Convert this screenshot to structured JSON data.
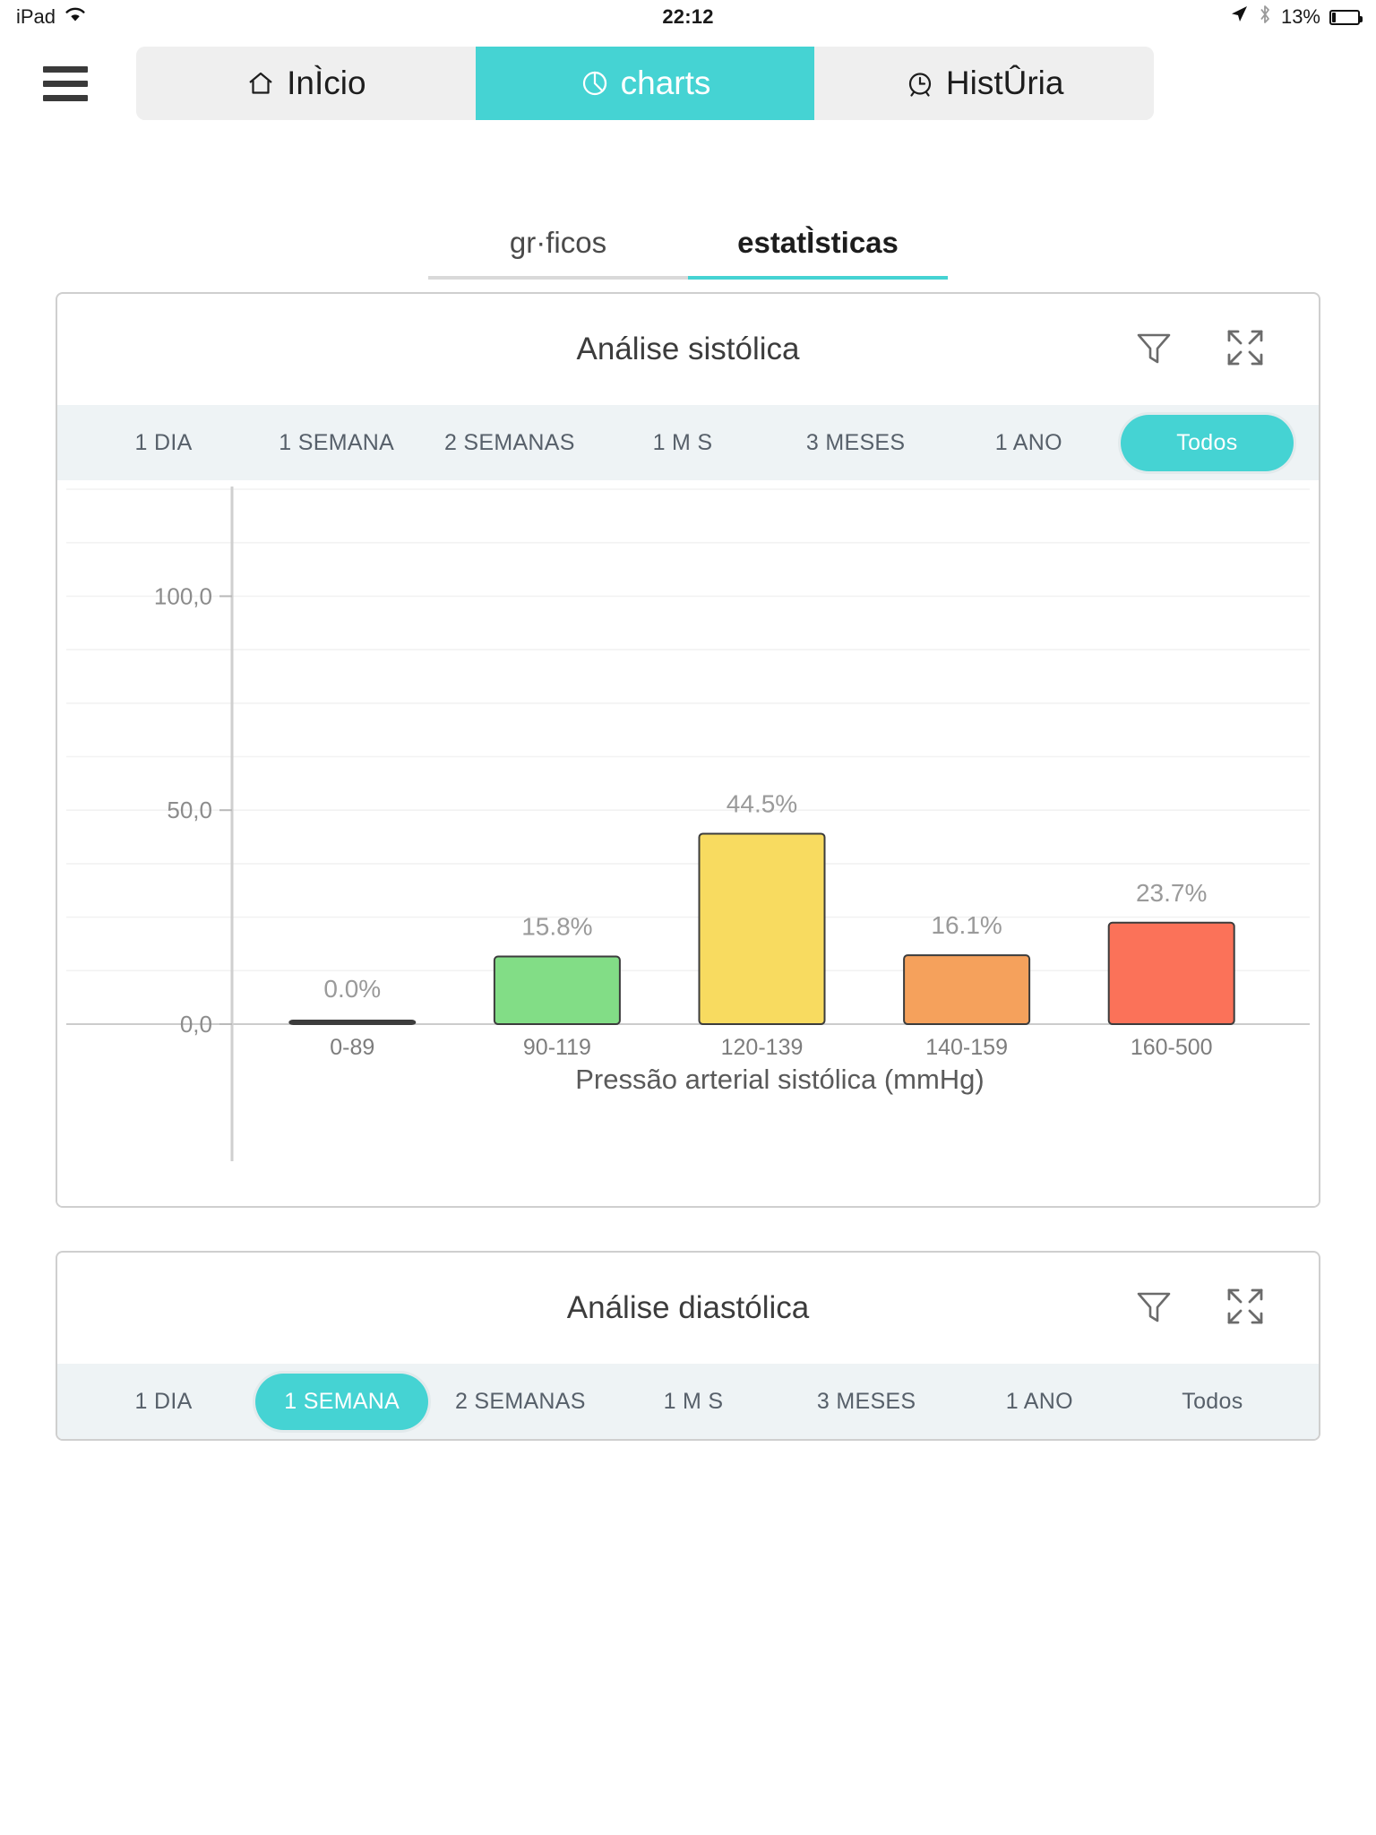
{
  "status_bar": {
    "device": "iPad",
    "wifi_icon": "wifi-icon",
    "time": "22:12",
    "location_icon": "location-arrow-icon",
    "bluetooth_icon": "bluetooth-icon",
    "battery_percent": "13%",
    "battery_level": 13
  },
  "top_nav": {
    "menu_icon": "hamburger-menu-icon",
    "tabs": [
      {
        "label": "InÌcio",
        "icon": "home-icon",
        "active": false
      },
      {
        "label": "charts",
        "icon": "pie-chart-icon",
        "active": true
      },
      {
        "label": "HistÛria",
        "icon": "alarm-clock-icon",
        "active": false
      }
    ]
  },
  "sub_tabs": [
    {
      "label": "gr·ficos",
      "active": false
    },
    {
      "label": "estatÌsticas",
      "active": true
    }
  ],
  "cards": [
    {
      "title": "Análise sistólica",
      "filter_icon": "filter-funnel-icon",
      "expand_icon": "expand-fullscreen-icon",
      "periods": [
        {
          "label": "1 DIA",
          "active": false
        },
        {
          "label": "1 SEMANA",
          "active": false
        },
        {
          "label": "2 SEMANAS",
          "active": false
        },
        {
          "label": "1 M S",
          "active": false
        },
        {
          "label": "3 MESES",
          "active": false
        },
        {
          "label": "1 ANO",
          "active": false
        },
        {
          "label": "Todos",
          "active": true
        }
      ]
    },
    {
      "title": "Análise diastólica",
      "filter_icon": "filter-funnel-icon",
      "expand_icon": "expand-fullscreen-icon",
      "periods": [
        {
          "label": "1 DIA",
          "active": false
        },
        {
          "label": "1 SEMANA",
          "active": true
        },
        {
          "label": "2 SEMANAS",
          "active": false
        },
        {
          "label": "1 M S",
          "active": false
        },
        {
          "label": "3 MESES",
          "active": false
        },
        {
          "label": "1 ANO",
          "active": false
        },
        {
          "label": "Todos",
          "active": false
        }
      ]
    }
  ],
  "chart_data": {
    "type": "bar",
    "title": "",
    "xlabel": "Pressão arterial sistólica (mmHg)",
    "ylabel": "",
    "categories": [
      "0-89",
      "90-119",
      "120-139",
      "140-159",
      "160-500"
    ],
    "values": [
      0.0,
      15.8,
      44.5,
      16.1,
      23.7
    ],
    "data_labels": [
      "0.0%",
      "15.8%",
      "44.5%",
      "16.1%",
      "23.7%"
    ],
    "colors": [
      "#82dd86",
      "#82dd86",
      "#f8db60",
      "#f5a15c",
      "#fb7259"
    ],
    "ylim": [
      0,
      125
    ],
    "yticks": [
      0,
      50,
      100
    ],
    "ytick_labels": [
      "0,0",
      "50,0",
      "100,0"
    ],
    "grid": true,
    "gridline_step": 12.5,
    "legend": "none"
  },
  "theme": {
    "accent": "#45d3d3",
    "period_bar_bg": "#eef3f5",
    "card_border": "#cfcfcf",
    "text_dark": "#1d1d1d",
    "text_muted": "#8a8a8a"
  }
}
